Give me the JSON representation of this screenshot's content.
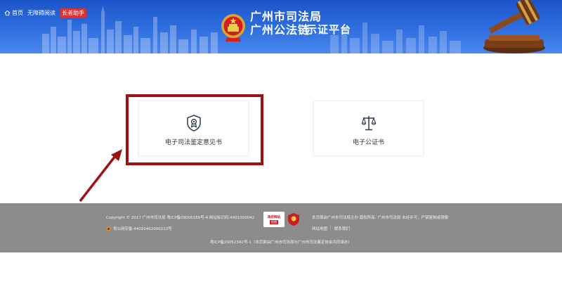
{
  "header": {
    "home_label": "首页",
    "accessible_label": "无障碍阅读",
    "elder_label": "长者助手",
    "title_line1": "广州市司法局",
    "title_line2": "广州公法链",
    "title_suffix": "示证平台"
  },
  "cards": [
    {
      "label": "电子司法鉴定意见书",
      "icon": "shield-award-icon"
    },
    {
      "label": "电子公证书",
      "icon": "scales-icon"
    }
  ],
  "footer": {
    "copyright": "Copyright © 2017 广州市司法局 粤ICP备09006188号-4 网站标识码:4401000042",
    "police_record": "粤公网安备 44010402000213号",
    "badge_top": "政府网站",
    "badge_bottom": "找错",
    "right_line": "本页面由广州市司法局主办 版权所有: 广州市司法局 未经许可，严禁复制或镜像",
    "links": [
      "网站地图",
      "联系我们"
    ],
    "icp_line2": "粤ICP备20052342号-1（本页面由广州市司法局与广州市司法鉴定协会共同承办）"
  },
  "colors": {
    "header_blue": "#2f6fe0",
    "highlight_red": "#a01010",
    "footer_gray": "#8c8c8c"
  }
}
